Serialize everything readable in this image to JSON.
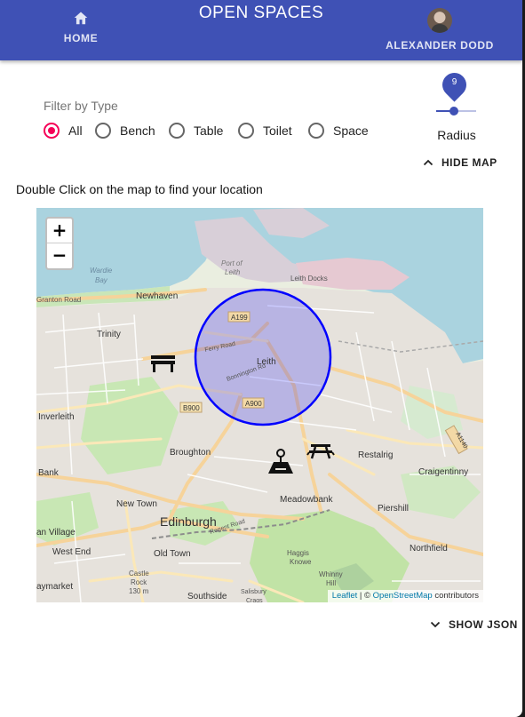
{
  "appbar": {
    "title": "OPEN SPACES",
    "home_label": "HOME",
    "user_name": "ALEXANDER DODD",
    "color": "#3f51b5"
  },
  "filter": {
    "label": "Filter by Type",
    "options": [
      "All",
      "Bench",
      "Table",
      "Toilet",
      "Space"
    ],
    "selected": "All",
    "accent": "#f50057"
  },
  "radius": {
    "label": "Radius",
    "value": "9"
  },
  "controls": {
    "hide_map": "HIDE MAP",
    "show_json": "SHOW JSON"
  },
  "hint": "Double Click on the map to find your location",
  "map": {
    "zoom_in": "+",
    "zoom_out": "−",
    "attribution": {
      "leaflet": "Leaflet",
      "separator": " | © ",
      "osm": "OpenStreetMap",
      "suffix": " contributors"
    },
    "places": [
      "Port of Leith",
      "Leith Docks",
      "Wardie Bay",
      "Newhaven",
      "Granton Road",
      "Trinity",
      "Leith",
      "A199",
      "A900",
      "B900",
      "Ferry Road",
      "Bonnington Rd",
      "Inverleith",
      "Broughton",
      "Restalrig",
      "Craigentinny",
      "Meadowbank",
      "Piershill",
      "Bank",
      "New Town",
      "Edinburgh",
      "Regent Road",
      "Old Town",
      "West End",
      "Northfield",
      "an Village",
      "aymarket",
      "Haggis Knowe",
      "Whinny Hill",
      "Castle Rock 130 m",
      "Southside",
      "Salisbury Crags",
      "A1140"
    ],
    "markers": [
      "bench-marker-icon",
      "picnic-table-marker-icon",
      "person-location-marker-icon"
    ],
    "radius_circle_color": "#0000ff"
  }
}
